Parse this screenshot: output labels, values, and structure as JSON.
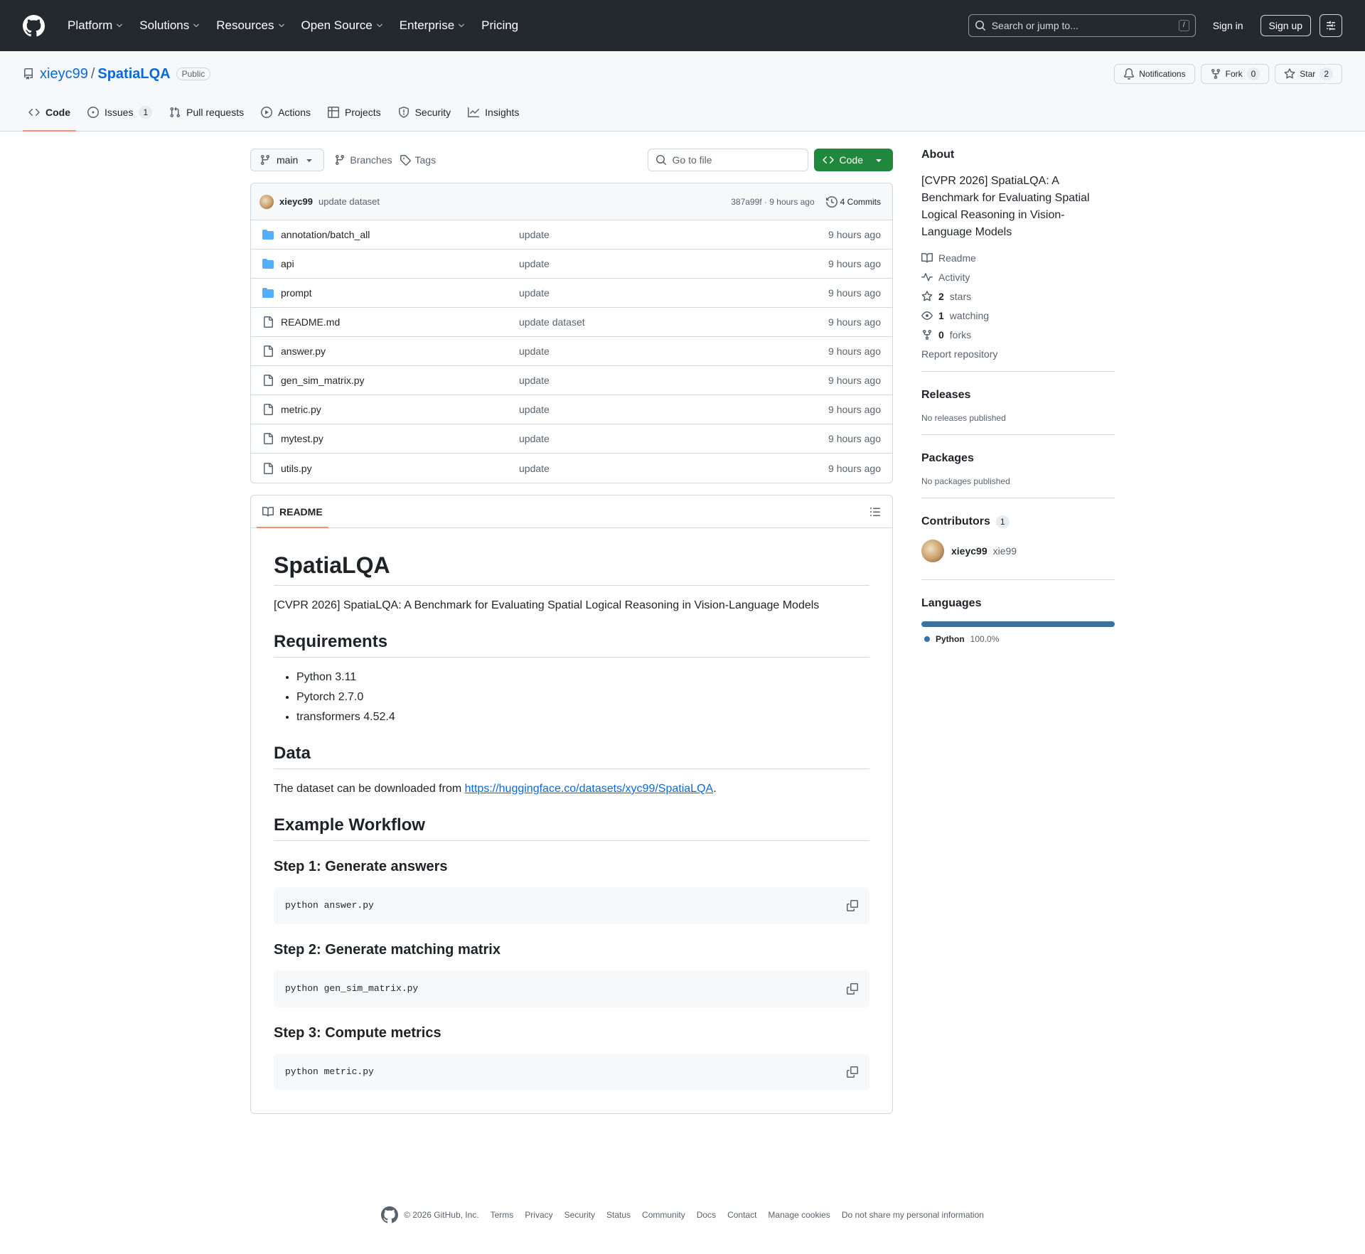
{
  "header": {
    "nav": [
      "Platform",
      "Solutions",
      "Resources",
      "Open Source",
      "Enterprise",
      "Pricing"
    ],
    "nav_has_chevron": [
      true,
      true,
      true,
      true,
      true,
      false
    ],
    "search_placeholder": "Search or jump to...",
    "search_kbd": "/",
    "signin": "Sign in",
    "signup": "Sign up"
  },
  "repo": {
    "owner": "xieyc99",
    "sep": "/",
    "name": "SpatiaLQA",
    "visibility": "Public",
    "notifications": "Notifications",
    "fork_label": "Fork",
    "fork_count": "0",
    "star_label": "Star",
    "star_count": "2"
  },
  "tabs": {
    "code": "Code",
    "issues": "Issues",
    "issues_count": "1",
    "pulls": "Pull requests",
    "actions": "Actions",
    "projects": "Projects",
    "security": "Security",
    "insights": "Insights"
  },
  "toolbar": {
    "branch": "main",
    "branches": "Branches",
    "tags": "Tags",
    "goto_placeholder": "Go to file",
    "code_button": "Code"
  },
  "commit": {
    "author": "xieyc99",
    "message": "update dataset",
    "meta": "387a99f · 9 hours ago",
    "commits": "4 Commits"
  },
  "files": [
    {
      "type": "folder",
      "name": "annotation/batch_all",
      "msg": "update",
      "time": "9 hours ago"
    },
    {
      "type": "folder",
      "name": "api",
      "msg": "update",
      "time": "9 hours ago"
    },
    {
      "type": "folder",
      "name": "prompt",
      "msg": "update",
      "time": "9 hours ago"
    },
    {
      "type": "file",
      "name": "README.md",
      "msg": "update dataset",
      "time": "9 hours ago"
    },
    {
      "type": "file",
      "name": "answer.py",
      "msg": "update",
      "time": "9 hours ago"
    },
    {
      "type": "file",
      "name": "gen_sim_matrix.py",
      "msg": "update",
      "time": "9 hours ago"
    },
    {
      "type": "file",
      "name": "metric.py",
      "msg": "update",
      "time": "9 hours ago"
    },
    {
      "type": "file",
      "name": "mytest.py",
      "msg": "update",
      "time": "9 hours ago"
    },
    {
      "type": "file",
      "name": "utils.py",
      "msg": "update",
      "time": "9 hours ago"
    }
  ],
  "readme": {
    "tab": "README",
    "h1": "SpatiaLQA",
    "intro": "[CVPR 2026] SpatiaLQA: A Benchmark for Evaluating Spatial Logical Reasoning in Vision-Language Models",
    "req_h": "Requirements",
    "reqs": [
      "Python 3.11",
      "Pytorch 2.7.0",
      "transformers 4.52.4"
    ],
    "data_h": "Data",
    "data_pre": "The dataset can be downloaded from ",
    "data_link": "https://huggingface.co/datasets/xyc99/SpatiaLQA",
    "data_post": ".",
    "workflow_h": "Example Workflow",
    "step1_h": "Step 1: Generate answers",
    "step1_code": "python answer.py",
    "step2_h": "Step 2: Generate matching matrix",
    "step2_code": "python gen_sim_matrix.py",
    "step3_h": "Step 3: Compute metrics",
    "step3_code": "python metric.py"
  },
  "about": {
    "title": "About",
    "description": "[CVPR 2026] SpatiaLQA: A Benchmark for Evaluating Spatial Logical Reasoning in Vision-Language Models",
    "readme": "Readme",
    "activity": "Activity",
    "stars_n": "2",
    "stars": "stars",
    "watching_n": "1",
    "watching": "watching",
    "forks_n": "0",
    "forks": "forks",
    "report": "Report repository"
  },
  "releases": {
    "title": "Releases",
    "text": "No releases published"
  },
  "packages": {
    "title": "Packages",
    "text": "No packages published"
  },
  "contributors": {
    "title": "Contributors",
    "count": "1",
    "login": "xieyc99",
    "name": "xie99"
  },
  "languages": {
    "title": "Languages",
    "name": "Python",
    "percent": "100.0%",
    "color": "#3572a5",
    "fraction": 1.0
  },
  "footer": {
    "copyright": "© 2026 GitHub, Inc.",
    "links": [
      "Terms",
      "Privacy",
      "Security",
      "Status",
      "Community",
      "Docs",
      "Contact",
      "Manage cookies",
      "Do not share my personal information"
    ]
  }
}
